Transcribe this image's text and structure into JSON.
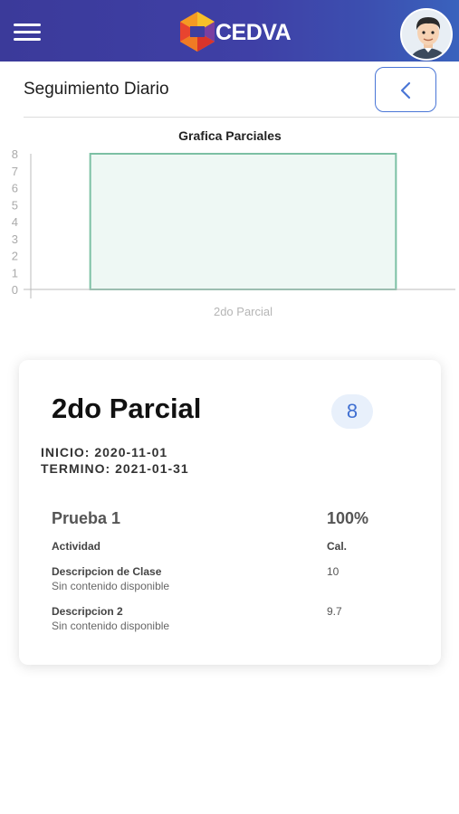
{
  "header": {
    "logo_text": "CEDVA",
    "colors": {
      "bar_start": "#3b3a9a",
      "bar_end": "#3a62bd"
    }
  },
  "page": {
    "title": "Seguimiento Diario",
    "back_icon": "chevron-left-icon"
  },
  "chart_data": {
    "type": "bar",
    "title": "Grafica Parciales",
    "categories": [
      "2do Parcial"
    ],
    "values": [
      8
    ],
    "ylim": [
      0,
      8
    ],
    "yticks": [
      "0",
      "1",
      "2",
      "3",
      "4",
      "5",
      "6",
      "7",
      "8"
    ],
    "xlabel": "",
    "ylabel": "",
    "bar_fill": "#eef8f4",
    "bar_stroke": "#7cc0a4",
    "grid": false
  },
  "card": {
    "title": "2do Parcial",
    "grade": "8",
    "inicio": "INICIO: 2020-11-01",
    "termino": "TERMINO: 2021-01-31",
    "prueba": {
      "name": "Prueba 1",
      "percent": "100%",
      "col_activity": "Actividad",
      "col_grade": "Cal.",
      "rows": [
        {
          "title": "Descripcion de Clase",
          "subtitle": "Sin contenido disponible",
          "grade": "10"
        },
        {
          "title": "Descripcion 2",
          "subtitle": "Sin contenido disponible",
          "grade": "9.7"
        }
      ]
    }
  }
}
